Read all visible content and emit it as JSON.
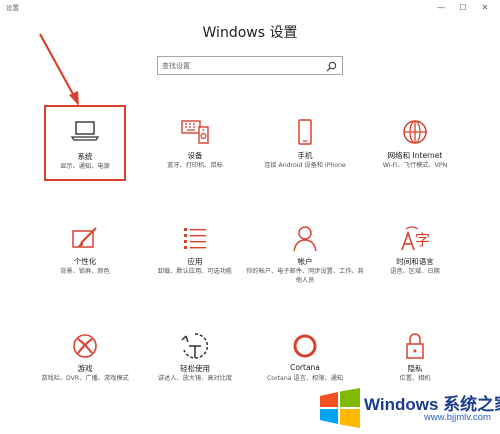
{
  "window": {
    "title": "设置",
    "minimize": "—",
    "maximize": "☐",
    "close": "✕"
  },
  "header": {
    "title": "Windows 设置"
  },
  "search": {
    "placeholder": "查找设置"
  },
  "accent_color": "#d9412f",
  "tiles": [
    {
      "icon": "laptop-icon",
      "name": "系统",
      "desc": "显示、通知、电源"
    },
    {
      "icon": "devices-icon",
      "name": "设备",
      "desc": "蓝牙、打印机、鼠标"
    },
    {
      "icon": "phone-icon",
      "name": "手机",
      "desc": "连接 Android 设备和 iPhone"
    },
    {
      "icon": "globe-icon",
      "name": "网络和 Internet",
      "desc": "Wi-Fi、飞行模式、VPN"
    },
    {
      "icon": "personalization-icon",
      "name": "个性化",
      "desc": "背景、锁屏、颜色"
    },
    {
      "icon": "apps-icon",
      "name": "应用",
      "desc": "卸载、默认应用、可选功能"
    },
    {
      "icon": "person-icon",
      "name": "帐户",
      "desc": "你的帐户、电子邮件、同步设置、工作、其他人员"
    },
    {
      "icon": "time-language-icon",
      "name": "时间和语言",
      "desc": "语音、区域、日期"
    },
    {
      "icon": "xbox-icon",
      "name": "游戏",
      "desc": "游戏栏、DVR、广播、游戏模式"
    },
    {
      "icon": "ease-of-access-icon",
      "name": "轻松使用",
      "desc": "讲述人、放大镜、高对比度"
    },
    {
      "icon": "cortana-icon",
      "name": "Cortana",
      "desc": "Cortana 语言、权限、通知"
    },
    {
      "icon": "lock-icon",
      "name": "隐私",
      "desc": "位置、相机"
    }
  ],
  "watermark": {
    "brand": "Windows 系统之家",
    "url": "www.bjjmlv.com"
  }
}
